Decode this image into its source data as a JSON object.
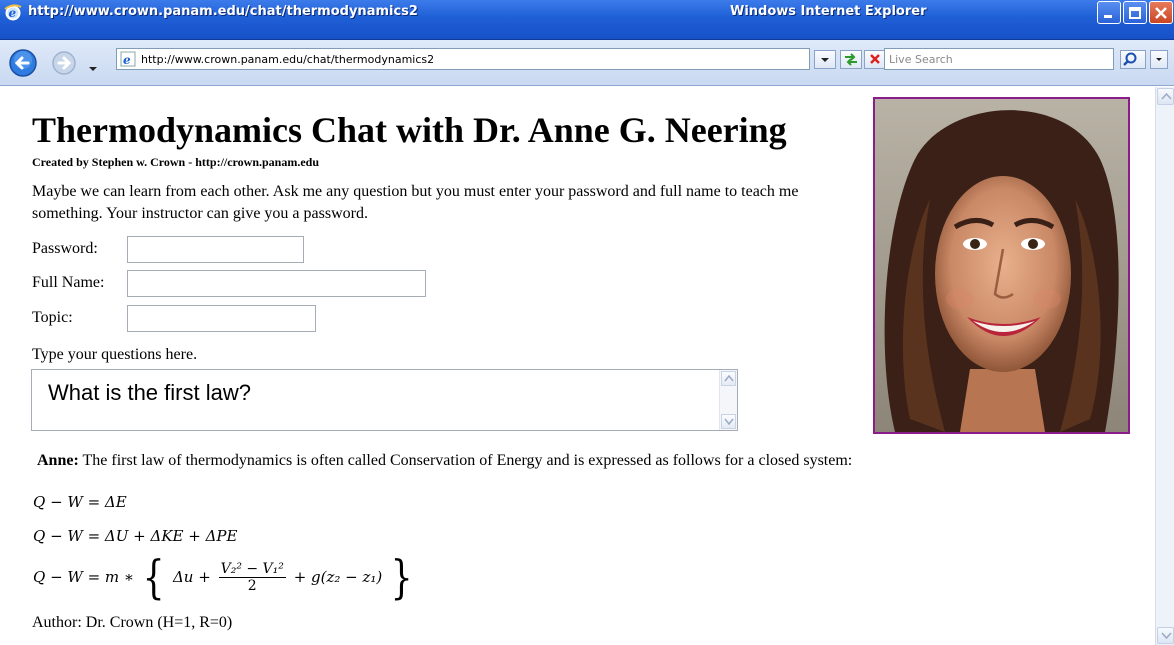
{
  "window": {
    "title": "http://www.crown.panam.edu/chat/thermodynamics2",
    "app_name": "Windows Internet Explorer"
  },
  "toolbar": {
    "address": "http://www.crown.panam.edu/chat/thermodynamics2",
    "search_placeholder": "Live Search"
  },
  "page": {
    "title": "Thermodynamics Chat with Dr. Anne G. Neering",
    "credit": "Created by Stephen w. Crown - http://crown.panam.edu",
    "intro": "Maybe we can learn from each other. Ask me any question but you must enter your password and full name to teach me something. Your instructor can give you a password.",
    "form": {
      "password_label": "Password:",
      "password_value": "",
      "fullname_label": "Full Name:",
      "fullname_value": "",
      "topic_label": "Topic:",
      "topic_value": ""
    },
    "question_label": "Type your questions here.",
    "question_text": "What is the first law?",
    "answer_speaker": "Anne:",
    "answer_text": "The first law of thermodynamics is often called Conservation of Energy and is expressed as follows for a closed system:",
    "equations": {
      "eq1": "Q − W = ΔE",
      "eq2": "Q − W = ΔU + ΔKE + ΔPE",
      "eq3_lhs": "Q − W = m ∗",
      "eq3_a": "Δu +",
      "eq3_num": "V₂² − V₁²",
      "eq3_den": "2",
      "eq3_b": "+ g(z₂ − z₁)"
    },
    "author": "Author: Dr. Crown (H=1, R=0)"
  },
  "colors": {
    "photo_border": "#8a1c8c",
    "titlebar": "#1f5fd6"
  }
}
